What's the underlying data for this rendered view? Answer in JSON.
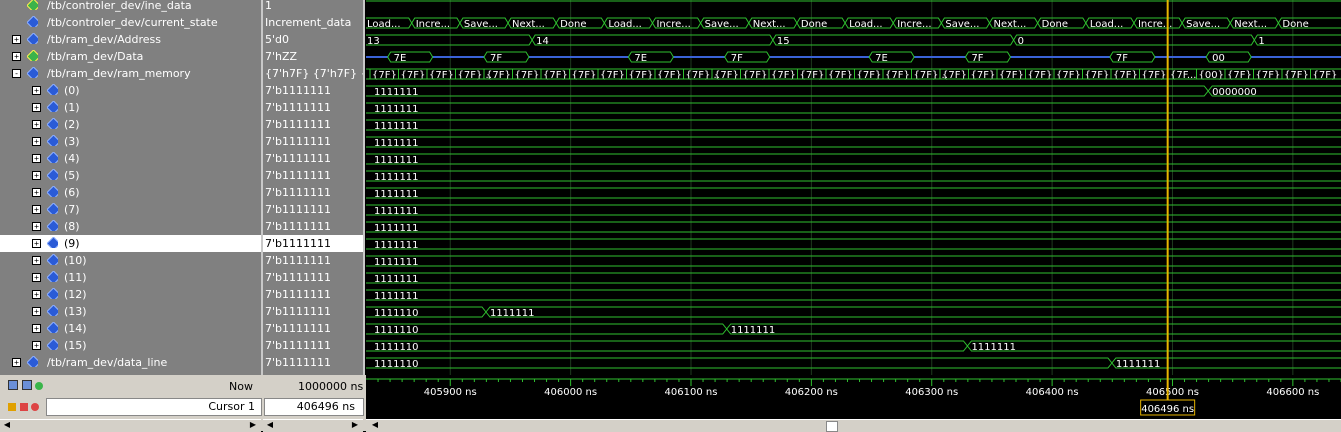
{
  "signals": [
    {
      "name": "/tb/controler_dev/ine_data",
      "value": "1",
      "expand": "",
      "icon": "green",
      "indent": 1
    },
    {
      "name": "/tb/controler_dev/current_state",
      "value": "Increment_data",
      "expand": "",
      "icon": "blue",
      "indent": 1
    },
    {
      "name": "/tb/ram_dev/Address",
      "value": "5'd0",
      "expand": "+",
      "icon": "blue",
      "indent": 0
    },
    {
      "name": "/tb/ram_dev/Data",
      "value": "7'hZZ",
      "expand": "+",
      "icon": "green",
      "indent": 0
    },
    {
      "name": "/tb/ram_dev/ram_memory",
      "value": "{7'h7F} {7'h7F} {...",
      "expand": "-",
      "icon": "blue",
      "indent": 0
    },
    {
      "name": "(0)",
      "value": "7'b1111111",
      "expand": "+",
      "icon": "blue",
      "indent": 2
    },
    {
      "name": "(1)",
      "value": "7'b1111111",
      "expand": "+",
      "icon": "blue",
      "indent": 2
    },
    {
      "name": "(2)",
      "value": "7'b1111111",
      "expand": "+",
      "icon": "blue",
      "indent": 2
    },
    {
      "name": "(3)",
      "value": "7'b1111111",
      "expand": "+",
      "icon": "blue",
      "indent": 2
    },
    {
      "name": "(4)",
      "value": "7'b1111111",
      "expand": "+",
      "icon": "blue",
      "indent": 2
    },
    {
      "name": "(5)",
      "value": "7'b1111111",
      "expand": "+",
      "icon": "blue",
      "indent": 2
    },
    {
      "name": "(6)",
      "value": "7'b1111111",
      "expand": "+",
      "icon": "blue",
      "indent": 2
    },
    {
      "name": "(7)",
      "value": "7'b1111111",
      "expand": "+",
      "icon": "blue",
      "indent": 2
    },
    {
      "name": "(8)",
      "value": "7'b1111111",
      "expand": "+",
      "icon": "blue",
      "indent": 2
    },
    {
      "name": "(9)",
      "value": "7'b1111111",
      "expand": "+",
      "icon": "blue",
      "indent": 2,
      "selected": true
    },
    {
      "name": "(10)",
      "value": "7'b1111111",
      "expand": "+",
      "icon": "blue",
      "indent": 2
    },
    {
      "name": "(11)",
      "value": "7'b1111111",
      "expand": "+",
      "icon": "blue",
      "indent": 2
    },
    {
      "name": "(12)",
      "value": "7'b1111111",
      "expand": "+",
      "icon": "blue",
      "indent": 2
    },
    {
      "name": "(13)",
      "value": "7'b1111111",
      "expand": "+",
      "icon": "blue",
      "indent": 2
    },
    {
      "name": "(14)",
      "value": "7'b1111111",
      "expand": "+",
      "icon": "blue",
      "indent": 2
    },
    {
      "name": "(15)",
      "value": "7'b1111111",
      "expand": "+",
      "icon": "blue",
      "indent": 2
    },
    {
      "name": "/tb/ram_dev/data_line",
      "value": "7'b1111111",
      "expand": "+",
      "icon": "blue",
      "indent": 0
    }
  ],
  "waves": {
    "ine_data": [],
    "current_state": [
      {
        "t": 405830,
        "label": "Load..."
      },
      {
        "t": 405868,
        "label": "Incre..."
      },
      {
        "t": 405908,
        "label": "Save..."
      },
      {
        "t": 405948,
        "label": "Next..."
      },
      {
        "t": 405988,
        "label": "Done"
      },
      {
        "t": 406028,
        "label": "Load..."
      },
      {
        "t": 406068,
        "label": "Incre..."
      },
      {
        "t": 406108,
        "label": "Save..."
      },
      {
        "t": 406148,
        "label": "Next..."
      },
      {
        "t": 406188,
        "label": "Done"
      },
      {
        "t": 406228,
        "label": "Load..."
      },
      {
        "t": 406268,
        "label": "Incre..."
      },
      {
        "t": 406308,
        "label": "Save..."
      },
      {
        "t": 406348,
        "label": "Next..."
      },
      {
        "t": 406388,
        "label": "Done"
      },
      {
        "t": 406428,
        "label": "Load..."
      },
      {
        "t": 406468,
        "label": "Incre..."
      },
      {
        "t": 406508,
        "label": "Save..."
      },
      {
        "t": 406548,
        "label": "Next..."
      },
      {
        "t": 406588,
        "label": "Done"
      }
    ],
    "address": [
      {
        "t": 405830,
        "label": "13"
      },
      {
        "t": 405968,
        "label": "14"
      },
      {
        "t": 406168,
        "label": "15"
      },
      {
        "t": 406368,
        "label": "0"
      },
      {
        "t": 406568,
        "label": "1"
      }
    ],
    "data_pulses": [
      {
        "t": 405848,
        "label": "7E"
      },
      {
        "t": 405928,
        "label": "7F"
      },
      {
        "t": 406048,
        "label": "7E"
      },
      {
        "t": 406128,
        "label": "7F"
      },
      {
        "t": 406248,
        "label": "7E"
      },
      {
        "t": 406328,
        "label": "7F"
      },
      {
        "t": 406448,
        "label": "7F"
      },
      {
        "t": 406528,
        "label": "00"
      }
    ],
    "ram_memory": [
      "{7F}",
      "{7F}",
      "{7F}",
      "{7F}...",
      "{7F}",
      "{7F}",
      "{7F}",
      "{7F}",
      "{7F}",
      "{7F}",
      "{7F}",
      "{7F}...",
      "{7F}",
      "{7F}",
      "{7F}",
      "{7F}",
      "{7F}",
      "{7F}",
      "{7F}",
      "{7F}...",
      "{7F}",
      "{7F}",
      "{7F}",
      "{7F}",
      "{7F}",
      "{7F}",
      "{7F}",
      "{7F}",
      "{7F...",
      "{00}",
      "{7F}",
      "{7F}",
      "{7F}",
      "{7F}"
    ],
    "memory_rows": [
      {
        "label": "1111111",
        "change_t": 406528,
        "new_label": "0000000"
      },
      {
        "label": "1111111"
      },
      {
        "label": "1111111"
      },
      {
        "label": "1111111"
      },
      {
        "label": "1111111"
      },
      {
        "label": "1111111"
      },
      {
        "label": "1111111"
      },
      {
        "label": "1111111"
      },
      {
        "label": "1111111"
      },
      {
        "label": "1111111"
      },
      {
        "label": "1111111"
      },
      {
        "label": "1111111"
      },
      {
        "label": "1111111"
      },
      {
        "label": "1111110",
        "change_t": 405928,
        "new_label": "1111111"
      },
      {
        "label": "1111110",
        "change_t": 406128,
        "new_label": "1111111"
      },
      {
        "label": "1111110",
        "change_t": 406328,
        "new_label": "1111111"
      }
    ],
    "data_line": {
      "label": "1111110",
      "change_t": 406448,
      "new_label": "1111111"
    }
  },
  "timeline": {
    "start": 405830,
    "end": 406640,
    "ticks": [
      "405900 ns",
      "406000 ns",
      "406100 ns",
      "406200 ns",
      "406300 ns",
      "406400 ns",
      "406500 ns",
      "406600 ns"
    ],
    "tick_values": [
      405900,
      406000,
      406100,
      406200,
      406300,
      406400,
      406500,
      406600
    ]
  },
  "now_label": "Now",
  "now_value": "1000000 ns",
  "cursor_label": "Cursor 1",
  "cursor_value": "406496 ns",
  "cursor_flag": "406496 ns",
  "cursor_time": 406496,
  "colors": {
    "wave": "#2fbf2f",
    "cursor": "#e8b500",
    "bus_z": "#3a62d8",
    "text": "#ffffff"
  }
}
